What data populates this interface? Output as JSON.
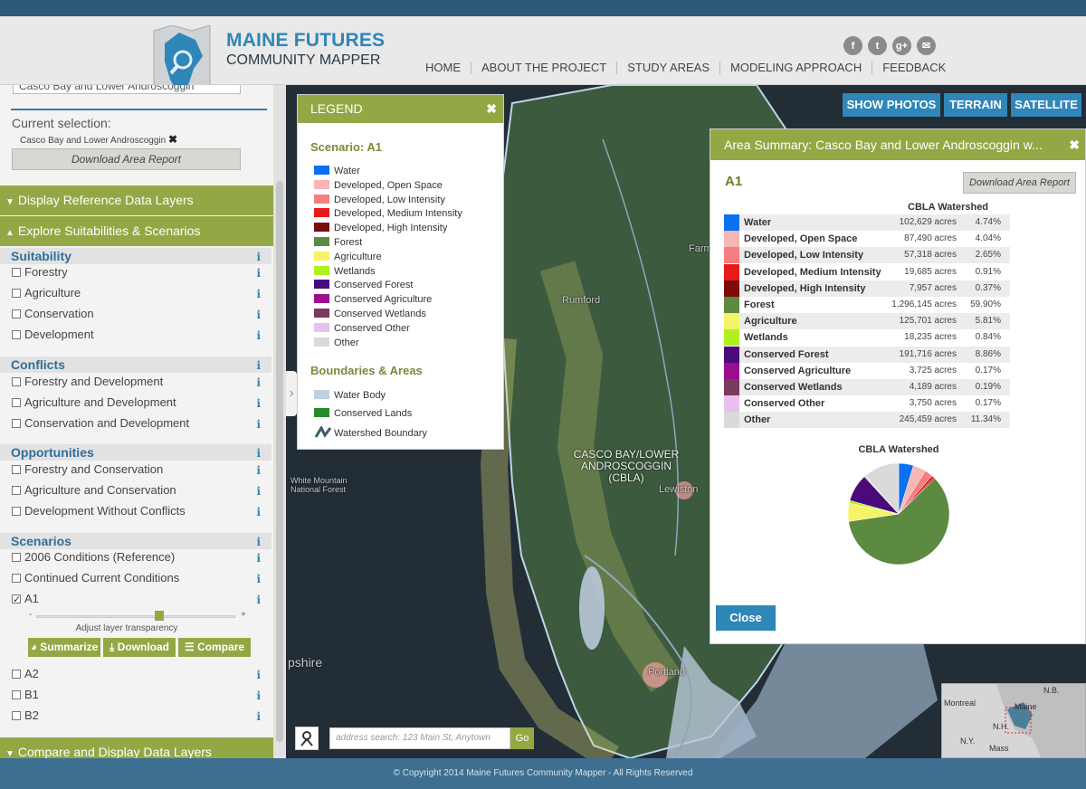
{
  "header": {
    "title": "MAINE FUTURES",
    "subtitle": "COMMUNITY MAPPER",
    "nav": [
      "HOME",
      "ABOUT THE PROJECT",
      "STUDY AREAS",
      "MODELING APPROACH",
      "FEEDBACK"
    ],
    "social": [
      {
        "icon": "facebook-icon",
        "glyph": "f"
      },
      {
        "icon": "twitter-icon",
        "glyph": "t"
      },
      {
        "icon": "google-plus-icon",
        "glyph": "g+"
      },
      {
        "icon": "email-icon",
        "glyph": "✉"
      }
    ]
  },
  "sidebar": {
    "study_area_select": "Casco Bay and Lower Androscoggin",
    "current_selection_label": "Current selection:",
    "current_selection_value": "Casco Bay and Lower Androscoggin",
    "download_report": "Download Area Report",
    "panel_reference": "Display Reference Data Layers",
    "panel_explore": "Explore Suitabilities & Scenarios",
    "panel_compare": "Compare and Display Data Layers",
    "info_glyph": "i",
    "sections": {
      "suitability": {
        "title": "Suitability",
        "items": [
          "Forestry",
          "Agriculture",
          "Conservation",
          "Development"
        ]
      },
      "conflicts": {
        "title": "Conflicts",
        "items": [
          "Forestry and Development",
          "Agriculture and Development",
          "Conservation and Development"
        ]
      },
      "opportunities": {
        "title": "Opportunities",
        "items": [
          "Forestry and Conservation",
          "Agriculture and Conservation",
          "Development Without Conflicts"
        ]
      },
      "scenarios": {
        "title": "Scenarios",
        "items": [
          "2006 Conditions (Reference)",
          "Continued Current Conditions",
          "A1",
          "A2",
          "B1",
          "B2"
        ]
      }
    },
    "transparency": {
      "label": "Adjust layer transparency",
      "minus": "-",
      "plus": "+",
      "value": 0.62
    },
    "actions": {
      "summarize": "Summarize",
      "download": "Download",
      "compare": "Compare"
    }
  },
  "map": {
    "buttons": {
      "photos": "SHOW PHOTOS",
      "terrain": "TERRAIN",
      "satellite": "SATELLITE"
    },
    "labels": {
      "rumford": "Rumford",
      "lewiston": "Lewiston",
      "portland": "Portland",
      "farmington": "Farmington",
      "white_mountain": "White Mountain National Forest",
      "shire": "pshire",
      "watershed_1": "CASCO BAY/LOWER",
      "watershed_2": "ANDROSCOGGIN",
      "watershed_3": "(CBLA)"
    },
    "search_placeholder": "address search: 123 Main St, Anytown",
    "search_go": "Go",
    "overview_labels": {
      "montreal": "Montreal",
      "maine": "Maine",
      "nb": "N.B.",
      "ny": "N.Y.",
      "mass": "Mass",
      "nh": "N.H."
    }
  },
  "legend": {
    "header": "LEGEND",
    "close": "✖",
    "scenario_title": "Scenario: A1",
    "items": [
      {
        "label": "Water",
        "color": "#0a6ff0"
      },
      {
        "label": "Developed, Open Space",
        "color": "#f6b7b5"
      },
      {
        "label": "Developed, Low Intensity",
        "color": "#f67e7e"
      },
      {
        "label": "Developed, Medium Intensity",
        "color": "#e8181b"
      },
      {
        "label": "Developed, High Intensity",
        "color": "#7a0c0c"
      },
      {
        "label": "Forest",
        "color": "#5c8a41"
      },
      {
        "label": "Agriculture",
        "color": "#f4f46a"
      },
      {
        "label": "Wetlands",
        "color": "#b0f01f"
      },
      {
        "label": "Conserved Forest",
        "color": "#4a0a7a"
      },
      {
        "label": "Conserved Agriculture",
        "color": "#9b0c8e"
      },
      {
        "label": "Conserved Wetlands",
        "color": "#7a3a5e"
      },
      {
        "label": "Conserved Other",
        "color": "#e8c0f0"
      },
      {
        "label": "Other",
        "color": "#dadada"
      }
    ],
    "boundaries_title": "Boundaries & Areas",
    "boundaries": [
      {
        "label": "Water Body",
        "color": "#bfd0e4"
      },
      {
        "label": "Conserved Lands",
        "color": "#2a8a2a"
      },
      {
        "label": "Watershed Boundary",
        "color": "#3c5d6e"
      }
    ]
  },
  "summary": {
    "header": "Area Summary: Casco Bay and Lower Androscoggin w...",
    "close_x": "✖",
    "scenario": "A1",
    "download": "Download Area Report",
    "column": "CBLA Watershed",
    "rows": [
      {
        "name": "Water",
        "acres": "102,629 acres",
        "pct": "4.74%",
        "color": "#0a6ff0"
      },
      {
        "name": "Developed, Open Space",
        "acres": "87,490 acres",
        "pct": "4.04%",
        "color": "#f6b7b5"
      },
      {
        "name": "Developed, Low Intensity",
        "acres": "57,318 acres",
        "pct": "2.65%",
        "color": "#f67e7e"
      },
      {
        "name": "Developed, Medium Intensity",
        "acres": "19,685 acres",
        "pct": "0.91%",
        "color": "#e8181b"
      },
      {
        "name": "Developed, High Intensity",
        "acres": "7,957 acres",
        "pct": "0.37%",
        "color": "#7a0c0c"
      },
      {
        "name": "Forest",
        "acres": "1,296,145 acres",
        "pct": "59.90%",
        "color": "#5c8a41"
      },
      {
        "name": "Agriculture",
        "acres": "125,701 acres",
        "pct": "5.81%",
        "color": "#f4f46a"
      },
      {
        "name": "Wetlands",
        "acres": "18,235 acres",
        "pct": "0.84%",
        "color": "#b0f01f"
      },
      {
        "name": "Conserved Forest",
        "acres": "191,716 acres",
        "pct": "8.86%",
        "color": "#4a0a7a"
      },
      {
        "name": "Conserved Agriculture",
        "acres": "3,725 acres",
        "pct": "0.17%",
        "color": "#9b0c8e"
      },
      {
        "name": "Conserved Wetlands",
        "acres": "4,189 acres",
        "pct": "0.19%",
        "color": "#7a3a5e"
      },
      {
        "name": "Conserved Other",
        "acres": "3,750 acres",
        "pct": "0.17%",
        "color": "#e8c0f0"
      },
      {
        "name": "Other",
        "acres": "245,459 acres",
        "pct": "11.34%",
        "color": "#dadada"
      }
    ],
    "pie_title": "CBLA Watershed",
    "close_button": "Close"
  },
  "chart_data": {
    "type": "pie",
    "title": "CBLA Watershed",
    "categories": [
      "Water",
      "Developed, Open Space",
      "Developed, Low Intensity",
      "Developed, Medium Intensity",
      "Developed, High Intensity",
      "Forest",
      "Agriculture",
      "Wetlands",
      "Conserved Forest",
      "Conserved Agriculture",
      "Conserved Wetlands",
      "Conserved Other",
      "Other"
    ],
    "values": [
      4.74,
      4.04,
      2.65,
      0.91,
      0.37,
      59.9,
      5.81,
      0.84,
      8.86,
      0.17,
      0.19,
      0.17,
      11.34
    ],
    "colors": [
      "#0a6ff0",
      "#f6b7b5",
      "#f67e7e",
      "#e8181b",
      "#7a0c0c",
      "#5c8a41",
      "#f4f46a",
      "#b0f01f",
      "#4a0a7a",
      "#9b0c8e",
      "#7a3a5e",
      "#e8c0f0",
      "#dadada"
    ]
  },
  "footer": {
    "copyright": "© Copyright 2014 Maine Futures Community Mapper - All Rights Reserved"
  }
}
